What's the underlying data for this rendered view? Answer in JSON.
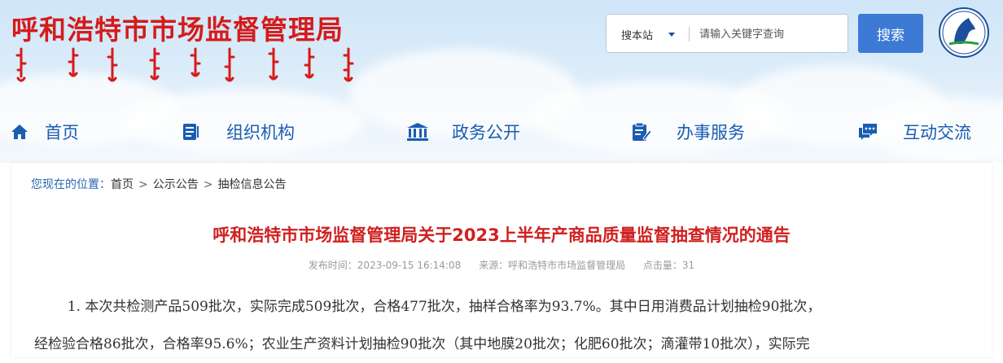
{
  "header": {
    "title": "呼和浩特市市场监督管理局",
    "search": {
      "scope": "搜本站",
      "placeholder": "请输入关键字查询",
      "button": "搜索"
    }
  },
  "nav": [
    {
      "label": "首页",
      "icon": "home-icon"
    },
    {
      "label": "组织机构",
      "icon": "organization-icon"
    },
    {
      "label": "政务公开",
      "icon": "government-building-icon"
    },
    {
      "label": "办事服务",
      "icon": "service-form-icon"
    },
    {
      "label": "互动交流",
      "icon": "chat-icon"
    }
  ],
  "breadcrumb": {
    "lead": "您现在的位置：",
    "items": [
      "首页",
      "公示公告",
      "抽检信息公告"
    ]
  },
  "article": {
    "title": "呼和浩特市市场监督管理局关于2023上半年产商品质量监督抽查情况的通告",
    "meta": {
      "publish_time": "发布时间：2023-09-15 16:14:08",
      "source": "来源：呼和浩特市市场监督管理局",
      "clicks": "点击量：31"
    },
    "paragraphs": [
      "1.  本次共检测产品509批次，实际完成509批次，合格477批次，抽样合格率为93.7%。其中日用消费品计划抽检90批次，",
      "经检验合格86批次，合格率95.6%；农业生产资料计划抽检90批次（其中地膜20批次；化肥60批次；滴灌带10批次），实际完"
    ]
  },
  "colors": {
    "brand_red": "#d51b1b",
    "nav_blue": "#1a5db2",
    "button_blue": "#3d7ad6",
    "breadcrumb_blue": "#2b67b4"
  }
}
